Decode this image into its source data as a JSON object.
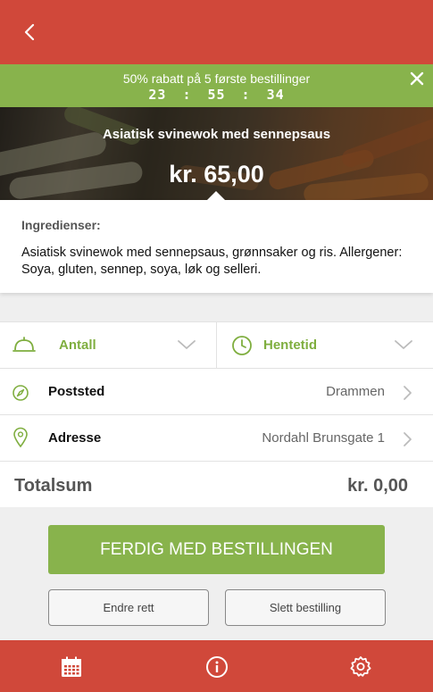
{
  "header": {
    "back_icon": "chevron-left-icon"
  },
  "promo": {
    "text": "50% rabatt på 5 første bestillinger",
    "timer": {
      "hours": "23",
      "sep1": ":",
      "minutes": "55",
      "sep2": ":",
      "seconds": "34"
    },
    "close_icon": "close-icon"
  },
  "dish": {
    "title": "Asiatisk svinewok med sennepsaus",
    "price": "kr. 65,00"
  },
  "ingredients": {
    "title": "Ingredienser:",
    "text": "Asiatisk svinewok med sennepsaus, grønnsaker og ris. Allergener: Soya, gluten, sennep, soya, løk og selleri."
  },
  "options": {
    "quantity_label": "Antall",
    "pickup_label": "Hentetid",
    "city_label": "Poststed",
    "city_value": "Drammen",
    "address_label": "Adresse",
    "address_value": "Nordahl Brunsgate 1"
  },
  "total": {
    "label": "Totalsum",
    "value": "kr. 0,00"
  },
  "actions": {
    "finish_label": "FERDIG MED BESTILLINGEN",
    "edit_label": "Endre rett",
    "delete_label": "Slett bestilling"
  },
  "tabbar": {
    "items": [
      "calendar-icon",
      "info-icon",
      "settings-icon"
    ]
  },
  "colors": {
    "red": "#d0483a",
    "green": "#88b34c",
    "green_text": "#7fae3f"
  }
}
